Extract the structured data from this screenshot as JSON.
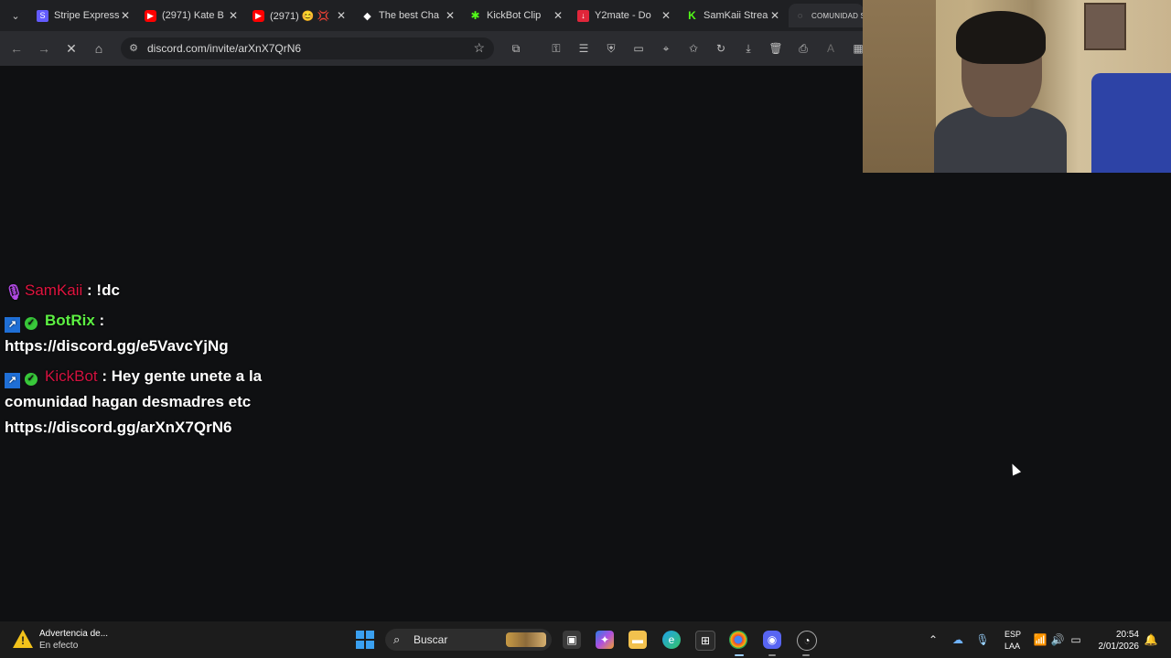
{
  "browser": {
    "tabs": [
      {
        "title": "Stripe Express",
        "favicon": "stripe-icon",
        "color": "#635bff"
      },
      {
        "title": "(2971) Kate B",
        "favicon": "youtube-icon",
        "color": "#ff0000"
      },
      {
        "title": "(2971) 😊 💢",
        "favicon": "youtube-icon",
        "color": "#ff0000"
      },
      {
        "title": "The best Cha",
        "favicon": "diamond-icon",
        "color": "#ffffff"
      },
      {
        "title": "KickBot Clip",
        "favicon": "kickbot-icon",
        "color": "#53fc18"
      },
      {
        "title": "Y2mate - Do",
        "favicon": "download-icon",
        "color": "#e0263a"
      },
      {
        "title": "SamKaii Strea",
        "favicon": "kick-icon",
        "color": "#53fc18"
      },
      {
        "title": "COMUNIDAD S",
        "favicon": "loading-icon",
        "color": "#bdbdbd"
      }
    ],
    "url": "discord.com/invite/arXnX7QrN6"
  },
  "chat": {
    "messages": [
      {
        "user": "SamKaii",
        "sep": " : ",
        "text": "!dc"
      },
      {
        "user": "BotRix",
        "sep": " :",
        "text": "https://discord.gg/e5VavcYjNg"
      },
      {
        "user": "KickBot",
        "sep": " : ",
        "text_line1": "Hey gente unete a la",
        "text_line2": "comunidad hagan desmadres etc",
        "text_line3": "https://discord.gg/arXnX7QrN6"
      }
    ]
  },
  "taskbar": {
    "warning_title": "Advertencia de...",
    "warning_sub": "En efecto",
    "search_placeholder": "Buscar",
    "lang_top": "ESP",
    "lang_bottom": "LAA",
    "time": "20:54",
    "date": "2/01/2026"
  },
  "colors": {
    "accent_pink": "#e0143f",
    "accent_green": "#5df043",
    "accent_red": "#d31240"
  }
}
